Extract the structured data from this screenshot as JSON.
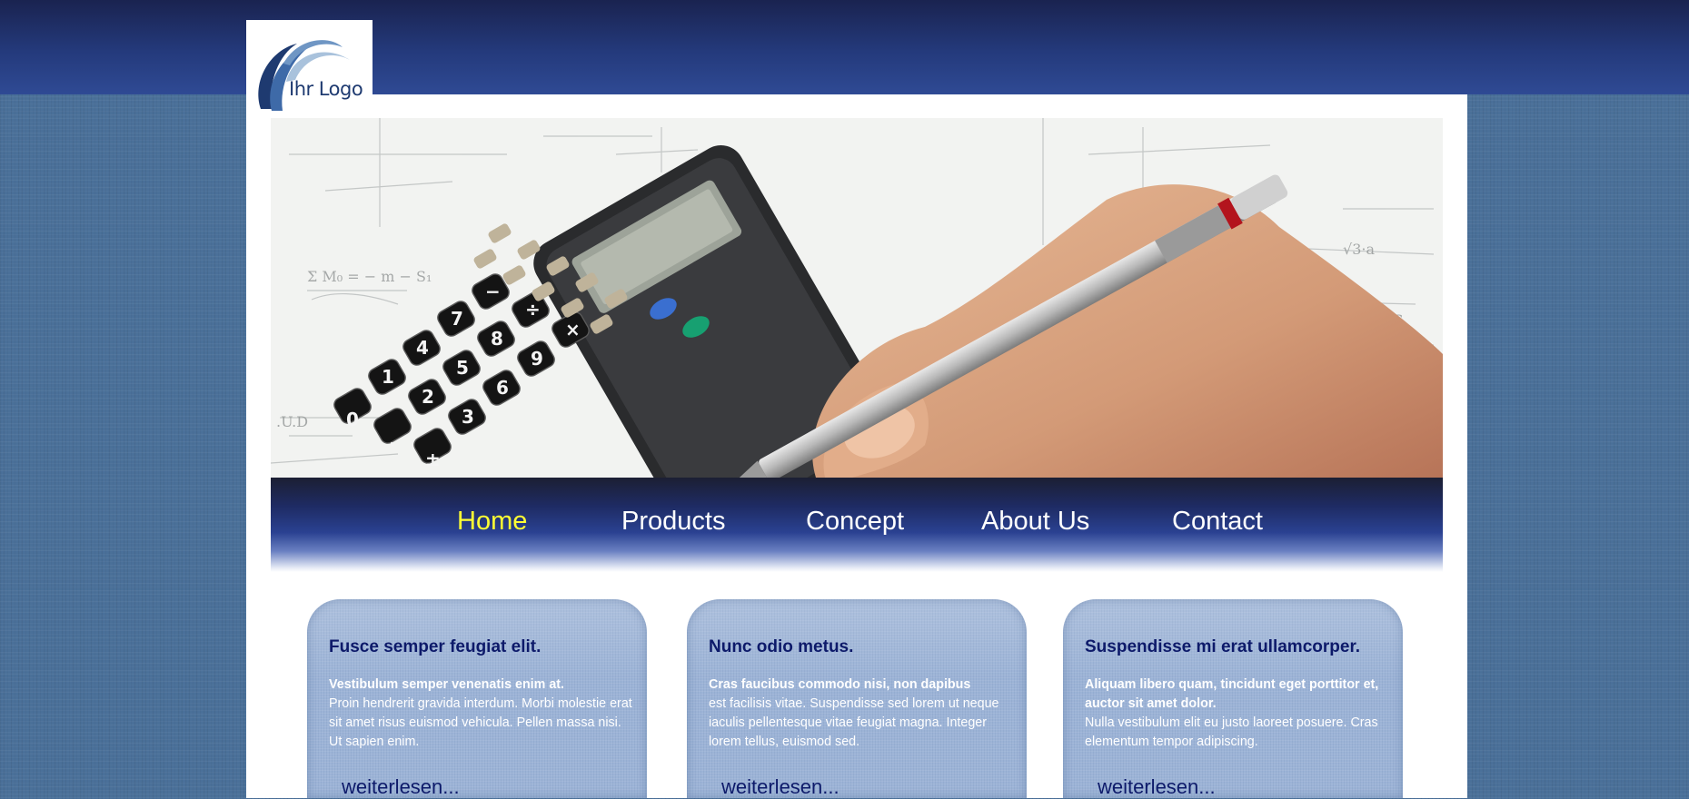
{
  "header": {
    "logo_text": "Ihr Logo"
  },
  "nav": {
    "items": [
      {
        "label": "Home",
        "active": true
      },
      {
        "label": "Products",
        "active": false
      },
      {
        "label": "Concept",
        "active": false
      },
      {
        "label": "About Us",
        "active": false
      },
      {
        "label": "Contact",
        "active": false
      }
    ]
  },
  "hero": {
    "image_alt": "",
    "calculator_keys": [
      "0",
      ".",
      "±",
      "1",
      "2",
      "3",
      "4",
      "5",
      "6",
      "7",
      "8",
      "9",
      "÷",
      "×",
      "−"
    ]
  },
  "cards": [
    {
      "title": "Fusce semper feugiat elit.",
      "lead": "Vestibulum semper venenatis enim at.",
      "body": "Proin hendrerit gravida interdum. Morbi molestie erat sit amet risus euismod vehicula. Pellen massa nisi. Ut sapien enim.",
      "more": "weiterlesen..."
    },
    {
      "title": "Nunc odio metus.",
      "lead": "Cras faucibus commodo nisi, non dapibus",
      "body": "est facilisis vitae. Suspendisse sed lorem ut neque iaculis pellentesque vitae feugiat magna. Integer lorem tellus, euismod sed.",
      "more": "weiterlesen..."
    },
    {
      "title": "Suspendisse mi erat ullamcorper.",
      "lead": "Aliquam libero quam, tincidunt eget porttitor et, auctor sit amet dolor.",
      "body": "Nulla vestibulum elit eu justo laoreet posuere. Cras elementum tempor adipiscing.",
      "more": "weiterlesen..."
    }
  ],
  "colors": {
    "header_bg": "#243a7c",
    "page_bg": "#4a7099",
    "nav_active": "#ffff33",
    "nav_text": "#ffffff",
    "card_bg": "#9cb3d6",
    "card_title": "#0d1a6a"
  }
}
